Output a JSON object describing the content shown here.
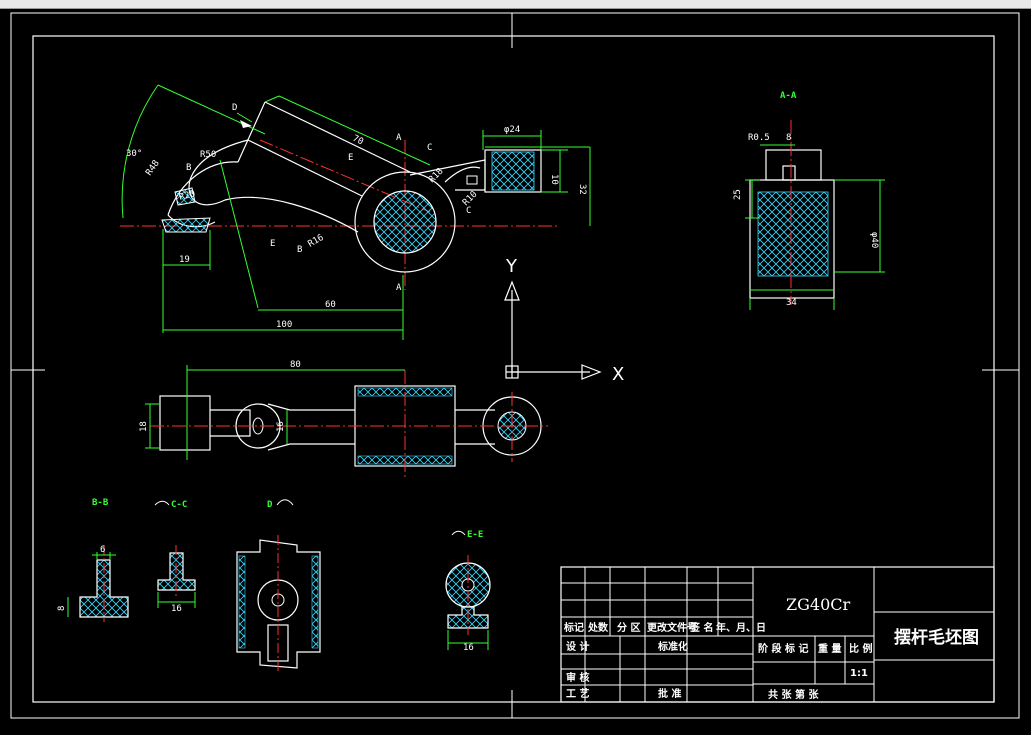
{
  "drawing": {
    "material": "ZG40Cr",
    "title": "摆杆毛坯图",
    "scale": "1:1"
  },
  "title_block": {
    "rev_headers": [
      "标记",
      "处数",
      "分 区",
      "更改文件号",
      "签 名",
      "年、月、日"
    ],
    "design": "设 计",
    "standardize": "标准化",
    "review": "审 核",
    "process": "工 艺",
    "approve": "批 准",
    "stage_mark": "阶 段 标 记",
    "weight": "重 量",
    "ratio": "比 例",
    "sheets": "共   张   第   张"
  },
  "views": {
    "aa_title": "A-A",
    "bb_title": "B-B",
    "cc_title": "C-C",
    "d_title": "D",
    "ee_title": "E-E"
  },
  "dims": {
    "d_30deg": "30°",
    "r48": "R48",
    "r50": "R50",
    "r20": "R20",
    "r16": "R16",
    "r18": "R18",
    "r10": "R10",
    "d70": "70",
    "d19": "19",
    "d60": "60",
    "d100": "100",
    "phi24": "φ24",
    "d10": "10",
    "d32": "32",
    "r05": "R0.5",
    "d8": "8",
    "d25": "25",
    "d40": "φ40",
    "d34": "34",
    "d80": "80",
    "d18": "18",
    "d16": "16",
    "d6": "6",
    "d8b": "8",
    "d16b": "16",
    "d16c": "16"
  },
  "markers": {
    "a_upper": "A",
    "a_lower": "A",
    "b1": "B",
    "b2": "B",
    "c1": "C",
    "c2": "C",
    "d_arrow": "D",
    "e1": "E",
    "e2": "E"
  },
  "ucs": {
    "x": "X",
    "y": "Y"
  }
}
